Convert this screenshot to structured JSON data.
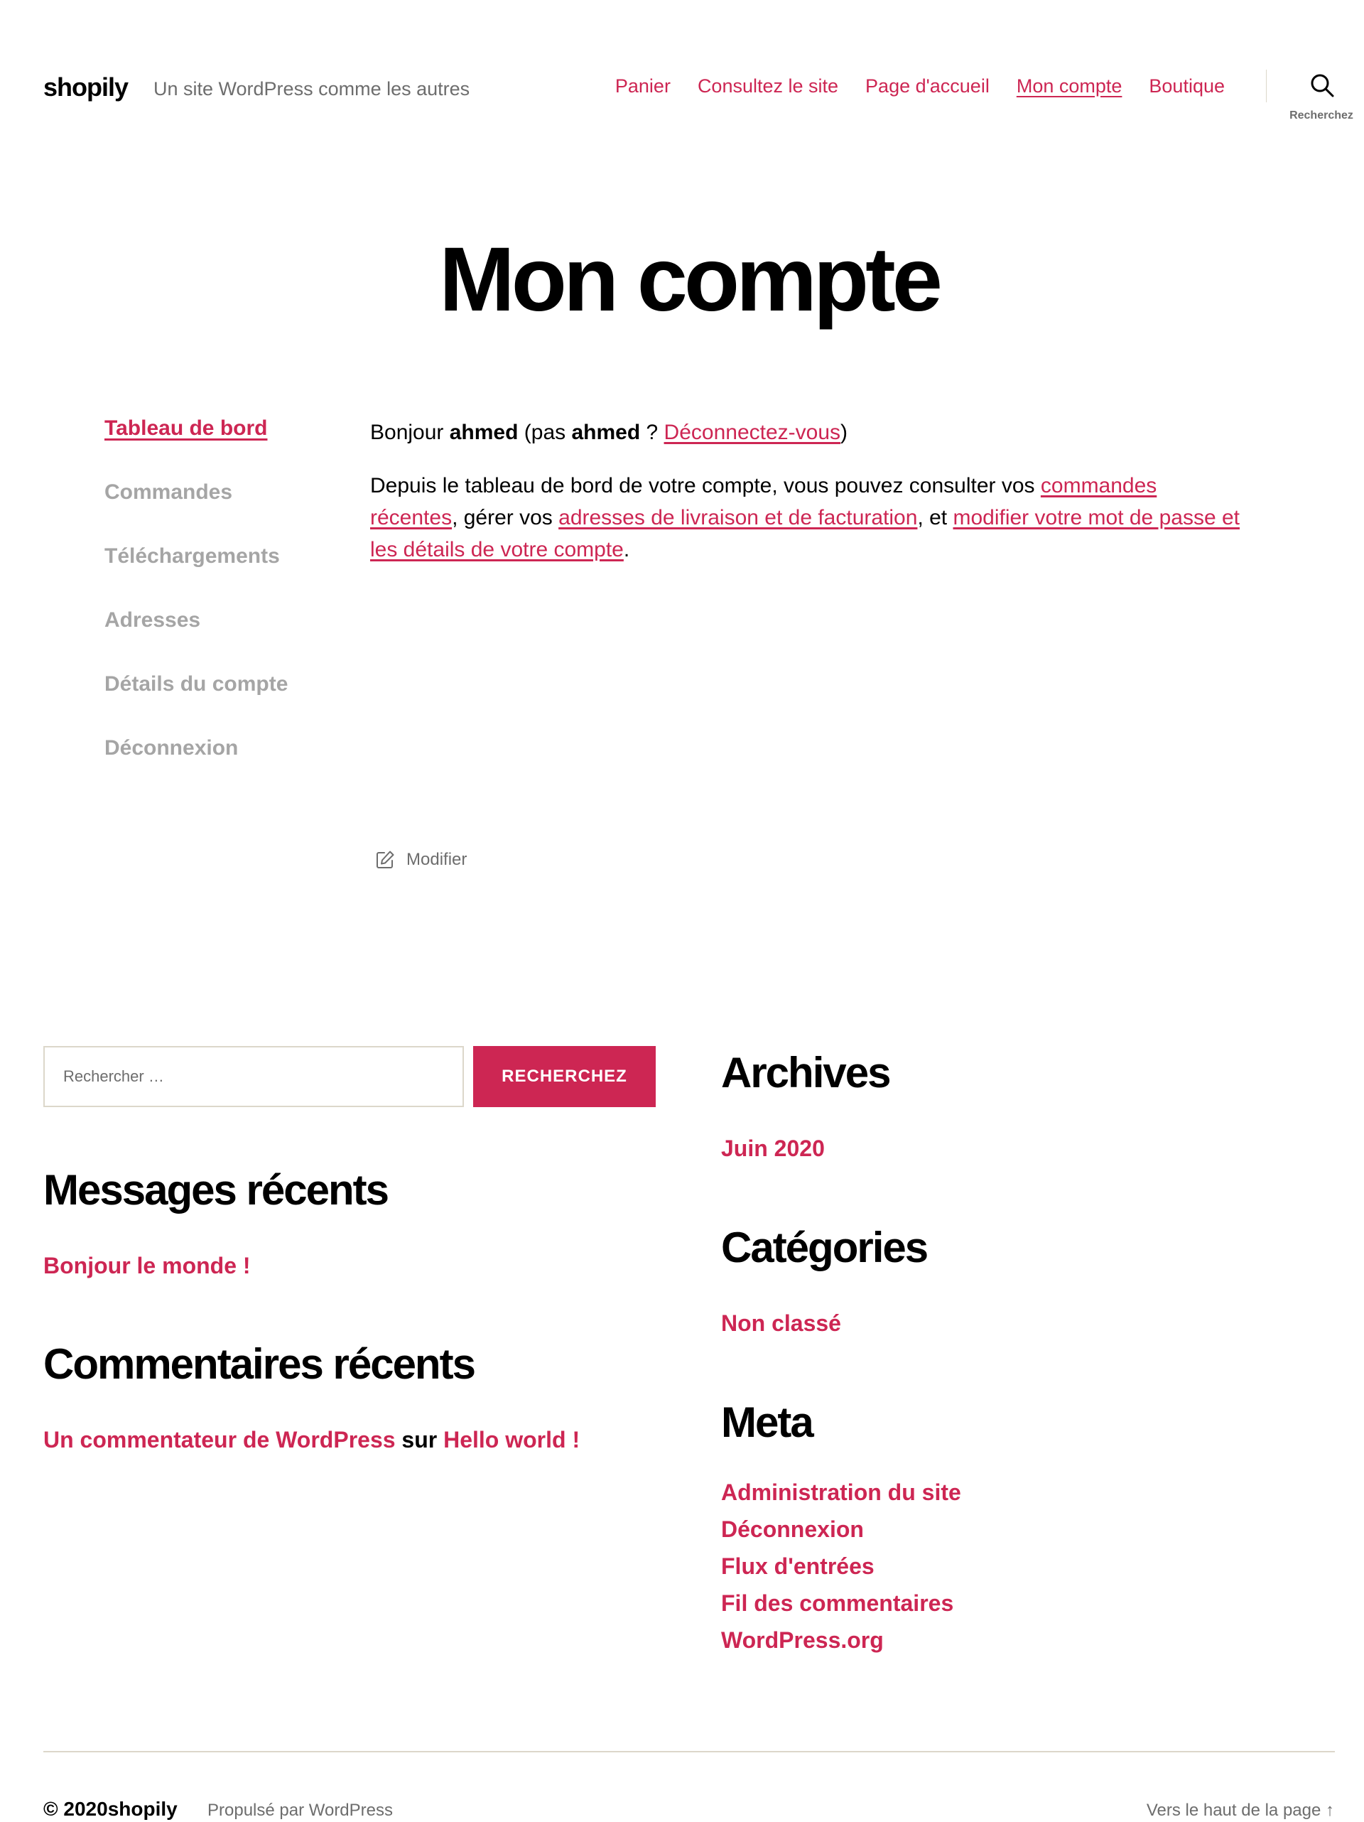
{
  "header": {
    "site_title": "shopily",
    "site_description": "Un site WordPress comme les autres",
    "nav": [
      {
        "label": "Panier"
      },
      {
        "label": "Consultez le site"
      },
      {
        "label": "Page d'accueil"
      },
      {
        "label": "Mon compte",
        "current": true
      },
      {
        "label": "Boutique"
      }
    ],
    "search_toggle_label": "Recherchez"
  },
  "page": {
    "title": "Mon compte"
  },
  "account_nav": [
    {
      "label": "Tableau de bord",
      "active": true
    },
    {
      "label": "Commandes"
    },
    {
      "label": "Téléchargements"
    },
    {
      "label": "Adresses"
    },
    {
      "label": "Détails du compte"
    },
    {
      "label": "Déconnexion"
    }
  ],
  "account_content": {
    "greeting": {
      "prefix": "Bonjour ",
      "username": "ahmed",
      "middle": " (pas ",
      "username_repeat": "ahmed",
      "question": " ? ",
      "logout_link": "Déconnectez-vous",
      "suffix": ")"
    },
    "intro": {
      "text_1": "Depuis le tableau de bord de votre compte, vous pouvez consulter vos ",
      "link_orders": "commandes récentes",
      "text_2": ", gérer vos ",
      "link_addresses": "adresses de livraison et de facturation",
      "text_3": ", et ",
      "link_account": "modifier votre mot de passe et les détails de votre compte",
      "text_4": "."
    },
    "edit_label": "Modifier"
  },
  "widgets": {
    "search": {
      "placeholder": "Rechercher …",
      "button_label": "RECHERCHEZ"
    },
    "recent_posts": {
      "title": "Messages récents",
      "items": [
        "Bonjour le monde !"
      ]
    },
    "recent_comments": {
      "title": "Commentaires récents",
      "author": "Un commentateur de WordPress",
      "connector": " sur ",
      "post": "Hello world !"
    },
    "archives": {
      "title": "Archives",
      "items": [
        "Juin 2020"
      ]
    },
    "categories": {
      "title": "Catégories",
      "items": [
        "Non classé"
      ]
    },
    "meta": {
      "title": "Meta",
      "items": [
        "Administration du site",
        "Déconnexion",
        "Flux d'entrées",
        "Fil des commentaires",
        "WordPress.org"
      ]
    }
  },
  "footer": {
    "copyright": "© 2020shopily",
    "powered_by": "Propulsé par WordPress",
    "back_to_top": "Vers le haut de la page ↑"
  },
  "colors": {
    "accent": "#cd2653",
    "muted_text": "#6d6d6d",
    "nav_inactive": "#a5a5a5",
    "border": "#dcd7ca"
  }
}
